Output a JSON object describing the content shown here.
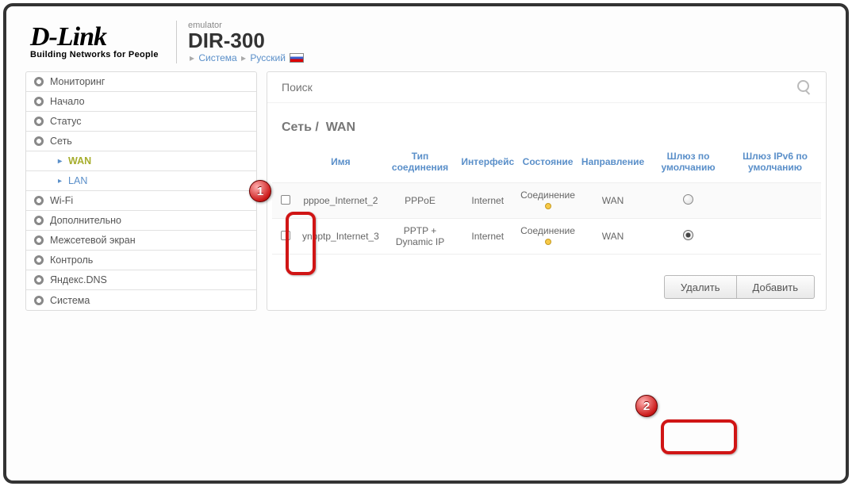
{
  "brand": {
    "name": "D-Link",
    "tag": "Building Networks for People"
  },
  "header": {
    "emulator": "emulator",
    "model": "DIR-300",
    "system_link": "Система",
    "lang_link": "Русский"
  },
  "search": {
    "placeholder": "Поиск"
  },
  "sidebar": {
    "items": [
      "Мониторинг",
      "Начало",
      "Статус",
      "Сеть"
    ],
    "sub": [
      {
        "label": "WAN",
        "active": true
      },
      {
        "label": "LAN",
        "active": false
      }
    ],
    "items2": [
      "Wi-Fi",
      "Дополнительно",
      "Межсетевой экран",
      "Контроль",
      "Яндекс.DNS",
      "Система"
    ]
  },
  "breadcrumb": {
    "parent": "Сеть",
    "current": "WAN"
  },
  "table": {
    "headers": [
      "",
      "Имя",
      "Тип соединения",
      "Интерфейс",
      "Состояние",
      "Направление",
      "Шлюз по умолчанию",
      "Шлюз IPv6 по умолчанию"
    ],
    "rows": [
      {
        "name": "pppoe_Internet_2",
        "type": "PPPoE",
        "iface": "Internet",
        "state": "Соединение",
        "dir": "WAN",
        "gw": "unchecked"
      },
      {
        "name": "ynpptp_Internet_3",
        "type": "PPTP + Dynamic IP",
        "iface": "Internet",
        "state": "Соединение",
        "dir": "WAN",
        "gw": "checked"
      }
    ]
  },
  "buttons": {
    "delete": "Удалить",
    "add": "Добавить"
  },
  "annotations": {
    "a1": "1",
    "a2": "2"
  }
}
